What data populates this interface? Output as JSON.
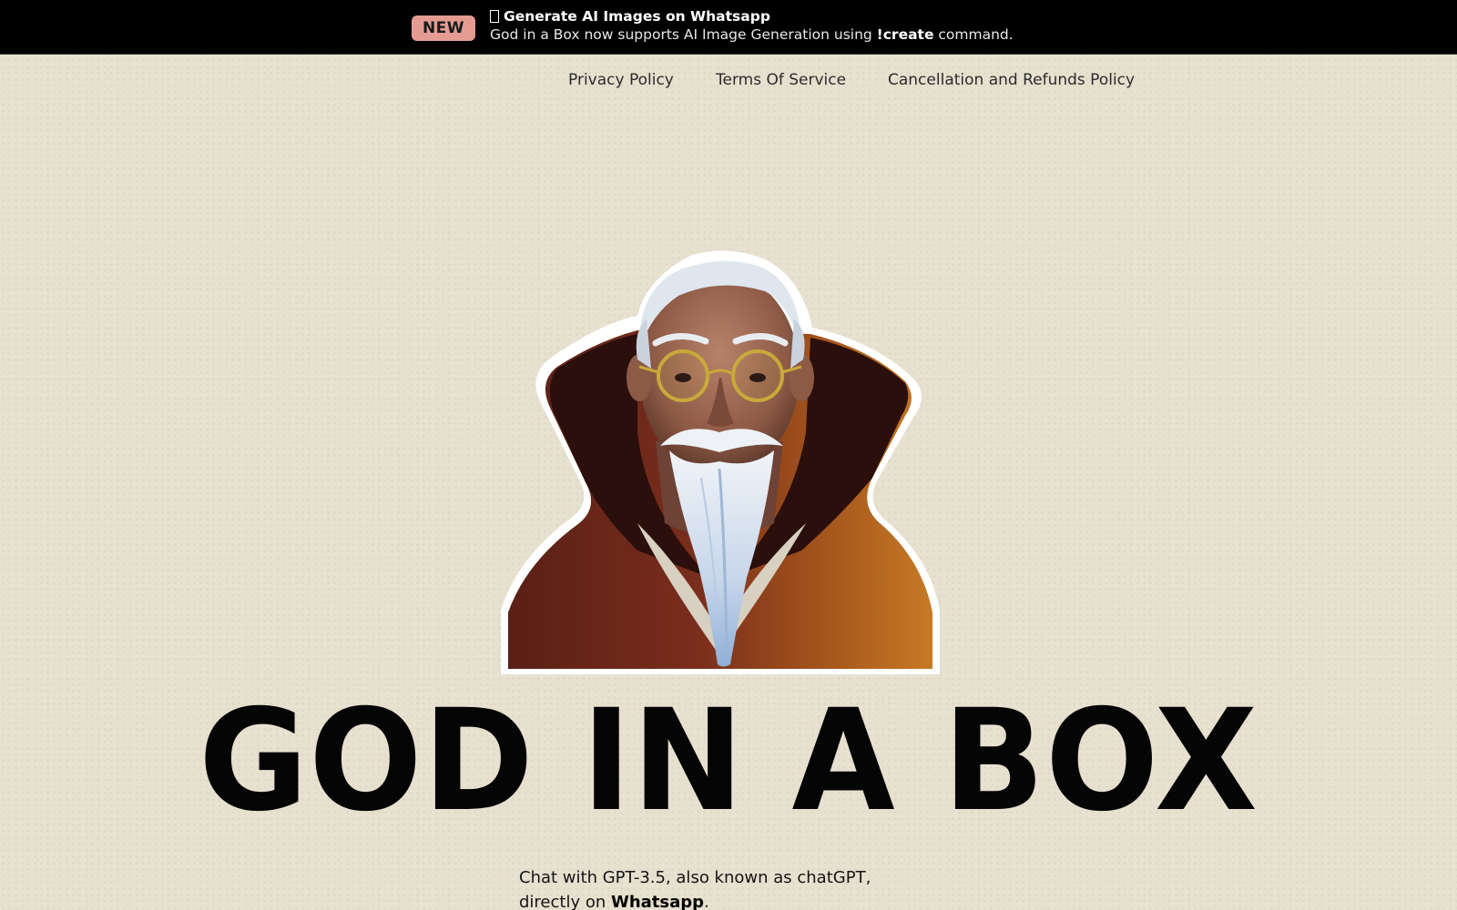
{
  "banner": {
    "badge": "NEW",
    "title": "Generate AI Images on Whatsapp",
    "title_icon": "missing-glyph-box",
    "text_before": "God in a Box now supports AI Image Generation using ",
    "command": "!create",
    "text_after": " command."
  },
  "nav": {
    "items": [
      {
        "label": "Privacy Policy"
      },
      {
        "label": "Terms Of Service"
      },
      {
        "label": "Cancellation and Refunds Policy"
      }
    ]
  },
  "hero": {
    "illustration": "bearded-old-man-with-glasses-and-high-collar-cloak",
    "title": "GOD IN A BOX"
  },
  "tagline": {
    "line1": "Chat with GPT-3.5, also known as chatGPT,",
    "before": "directly on ",
    "strong": "Whatsapp",
    "after": "."
  },
  "colors": {
    "background": "#e7e1d0",
    "banner": "#000000",
    "badge": "#e49b92",
    "title": "#050505"
  }
}
